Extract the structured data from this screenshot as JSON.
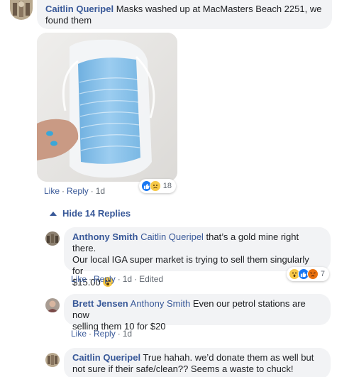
{
  "comments": [
    {
      "author": "Caitlin Queripel",
      "text": " Masks washed up at MacMasters Beach 2251, we found them",
      "actions": {
        "like": "Like",
        "reply": "Reply",
        "time": "1d"
      },
      "reactions": {
        "count": "18",
        "types": [
          "like-icon",
          "sad-icon"
        ]
      }
    }
  ],
  "thread": {
    "hide_label": "Hide 14 Replies"
  },
  "replies": [
    {
      "author": "Anthony Smith",
      "mention": "Caitlin Queripel",
      "text_line1": " that’s a gold mine right there.",
      "text_line2": "Our local IGA super market is trying to sell them singularly for",
      "text_line3": "$15.00 ",
      "actions": {
        "like": "Like",
        "reply": "Reply",
        "time": "1d",
        "edited": "Edited"
      },
      "reactions": {
        "count": "7",
        "types": [
          "wow-icon",
          "like-icon",
          "angry-icon"
        ]
      }
    },
    {
      "author": "Brett Jensen",
      "mention": "Anthony Smith",
      "text_line1": " Even our petrol stations are now",
      "text_line2": "selling them 10 for $20",
      "actions": {
        "like": "Like",
        "reply": "Reply",
        "time": "1d"
      }
    },
    {
      "author": "Caitlin Queripel",
      "text_line1": " True hahah. we’d donate them as well but",
      "text_line2": "not sure if their safe/clean?? Seems a waste to chuck!"
    }
  ],
  "colors": {
    "link": "#385898",
    "bubble": "#f2f3f5",
    "muted": "#606770",
    "like_blue": "#1877f2",
    "mask_blue": "#8fc3ea"
  }
}
